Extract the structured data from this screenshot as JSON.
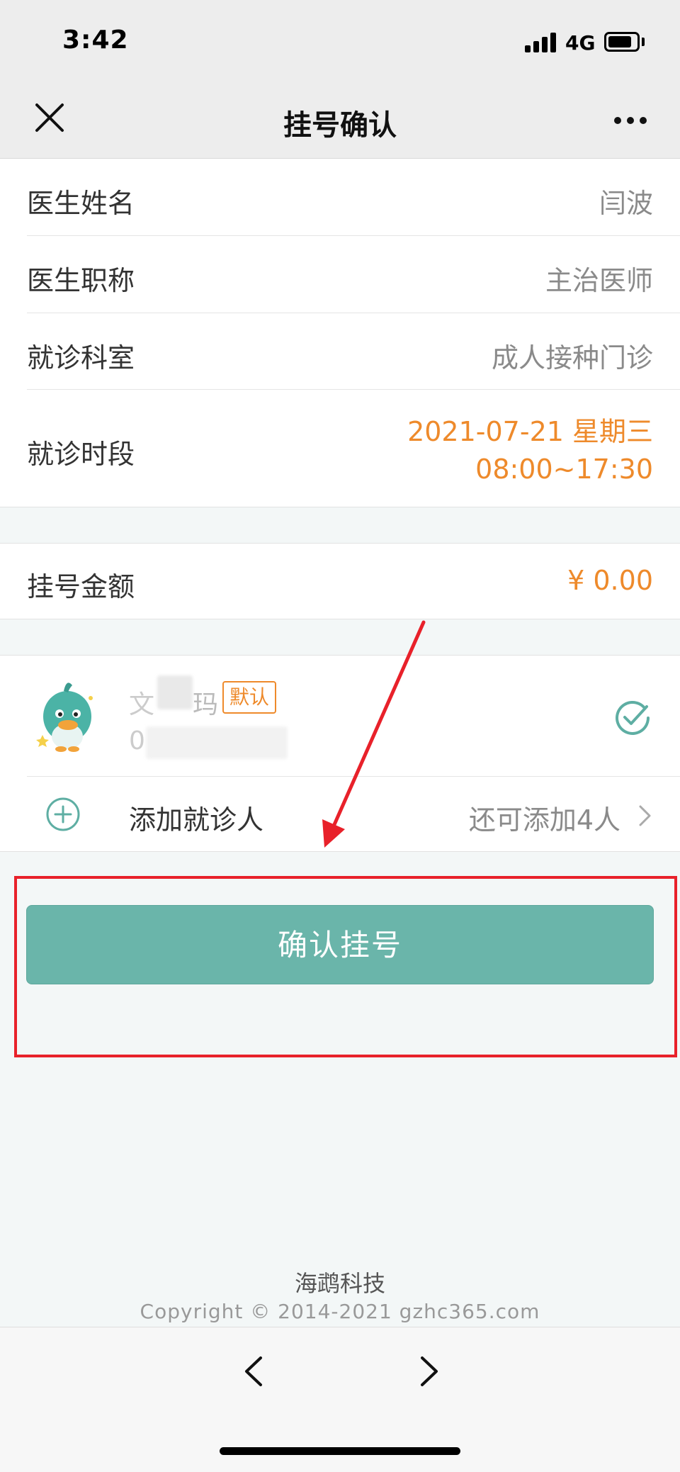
{
  "status_bar": {
    "time": "3:42",
    "network": "4G"
  },
  "nav": {
    "title": "挂号确认",
    "close_icon": "close-icon",
    "more_icon": "more-dots-icon"
  },
  "details": [
    {
      "label": "医生姓名",
      "value": "闫波"
    },
    {
      "label": "医生职称",
      "value": "主治医师"
    },
    {
      "label": "就诊科室",
      "value": "成人接种门诊"
    }
  ],
  "time_slot": {
    "label": "就诊时段",
    "date": "2021-07-21 星期三",
    "hours": "08:00~17:30"
  },
  "fee": {
    "label": "挂号金额",
    "value": "¥ 0.00"
  },
  "patient": {
    "name_first": "文",
    "name_last": "玛",
    "tag": "默认",
    "id_prefix": "0",
    "selected": true
  },
  "add_patient": {
    "label": "添加就诊人",
    "remaining": "还可添加4人"
  },
  "confirm_button": "确认挂号",
  "footer": {
    "company": "海鹉科技",
    "copyright": "Copyright © 2014-2021 gzhc365.com"
  },
  "colors": {
    "accent": "#6ab5aa",
    "orange": "#ee8a2b",
    "highlight": "#e8212a"
  }
}
